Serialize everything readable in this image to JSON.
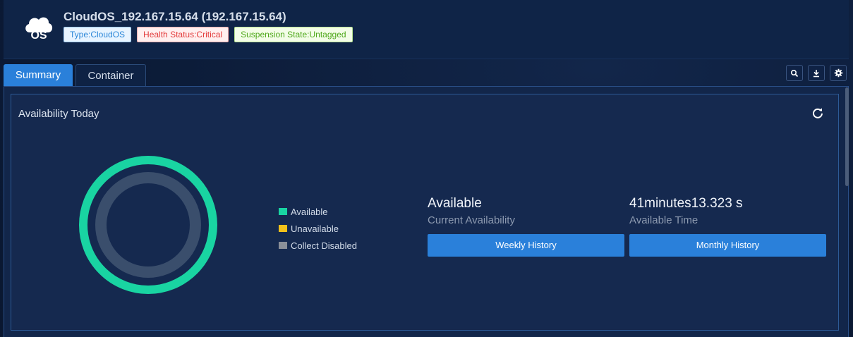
{
  "header": {
    "logo_text": "OS",
    "title": "CloudOS_192.167.15.64 (192.167.15.64)",
    "tags": {
      "type": "Type:CloudOS",
      "health": "Health Status:Critical",
      "suspension": "Suspension State:Untagged"
    }
  },
  "tabs": [
    {
      "label": "Summary",
      "active": true
    },
    {
      "label": "Container",
      "active": false
    }
  ],
  "toolbar": {
    "icons": [
      "search-icon",
      "download-icon",
      "settings-icon"
    ]
  },
  "availability": {
    "title": "Availability Today",
    "legend": [
      {
        "label": "Available",
        "color": "#19d4a2"
      },
      {
        "label": "Unavailable",
        "color": "#f3c11a"
      },
      {
        "label": "Collect Disabled",
        "color": "#8a8f98"
      }
    ],
    "current": {
      "value": "Available",
      "label": "Current Availability"
    },
    "time": {
      "value": "41minutes13.323 s",
      "label": "Available Time"
    },
    "buttons": {
      "weekly": "Weekly History",
      "monthly": "Monthly History"
    },
    "donut": {
      "available_fraction": 1.0,
      "ring_color": "#19d4a2",
      "inner_color": "#3a4e6c"
    }
  },
  "colors": {
    "accent": "#2a80da",
    "background": "#0c1b36"
  }
}
